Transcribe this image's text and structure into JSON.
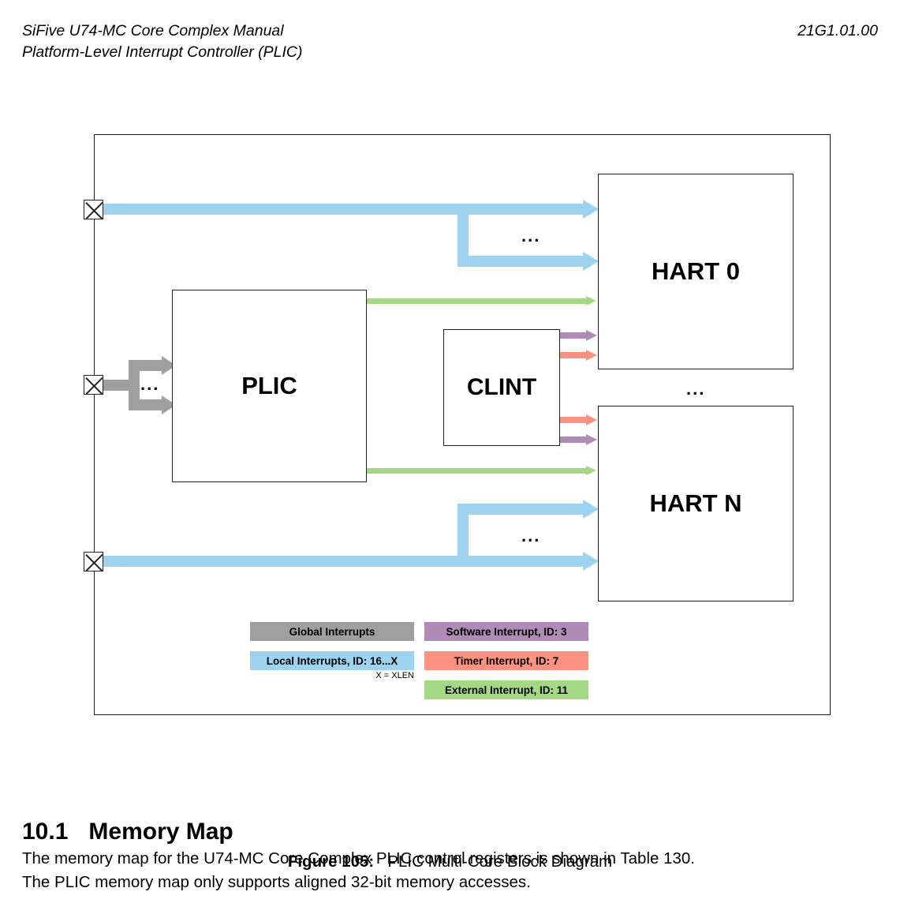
{
  "header": {
    "manual_title": "SiFive U74-MC Core Complex Manual",
    "chapter_title": "Platform-Level Interrupt Controller (PLIC)",
    "version": "21G1.01.00"
  },
  "figure": {
    "caption_label": "Figure 105:",
    "caption_text": "PLIC Multi-Core Block Diagram",
    "blocks": {
      "plic": "PLIC",
      "clint": "CLINT",
      "hart0": "HART 0",
      "hartn": "HART N"
    },
    "ellipsis": "...",
    "legend": {
      "global": "Global Interrupts",
      "local": "Local Interrupts, ID: 16...X",
      "software": "Software Interrupt, ID: 3",
      "timer": "Timer Interrupt, ID: 7",
      "external": "External Interrupt, ID: 11",
      "note": "X = XLEN"
    },
    "colors": {
      "global": "#9f9f9f",
      "local": "#9ed3f0",
      "software": "#b08bb8",
      "timer": "#fb9180",
      "external": "#a4d884"
    }
  },
  "section": {
    "number": "10.1",
    "title": "Memory Map",
    "body_line_1": "The memory map for the U74-MC Core Complex PLIC control registers is shown in Table 130.",
    "body_line_2": "The PLIC memory map only supports aligned 32-bit memory accesses."
  }
}
